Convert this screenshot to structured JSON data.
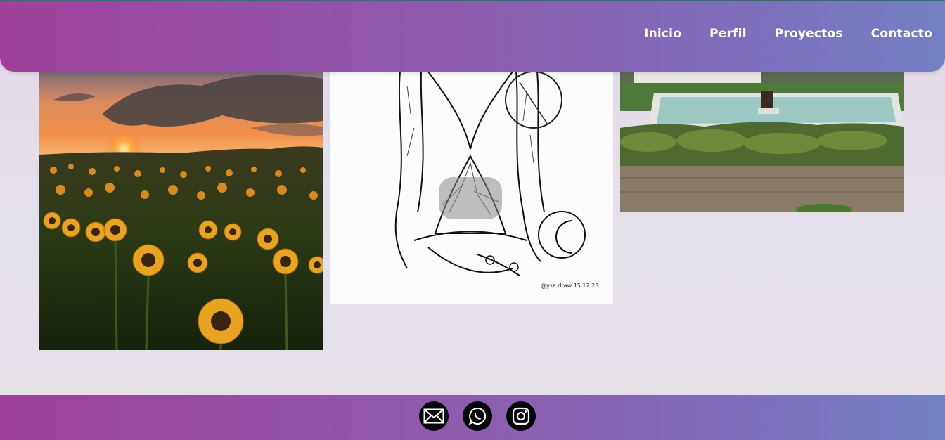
{
  "nav": {
    "items": [
      {
        "label": "Inicio"
      },
      {
        "label": "Perfil"
      },
      {
        "label": "Proyectos"
      },
      {
        "label": "Contacto"
      }
    ]
  },
  "gallery": {
    "images": [
      {
        "subject": "sunflower field at sunset"
      },
      {
        "subject": "ink drawing of hourglass with moon",
        "signature": "@ysa.draw 15.12.23"
      },
      {
        "subject": "garden fountain with hedges"
      }
    ]
  },
  "footer": {
    "icons": [
      "mail-icon",
      "whatsapp-icon",
      "instagram-icon"
    ]
  },
  "colors": {
    "gradient_start": "#a0409a",
    "gradient_end": "#7480c4",
    "background": "#e4e0ea",
    "icon_bg": "#050505"
  }
}
